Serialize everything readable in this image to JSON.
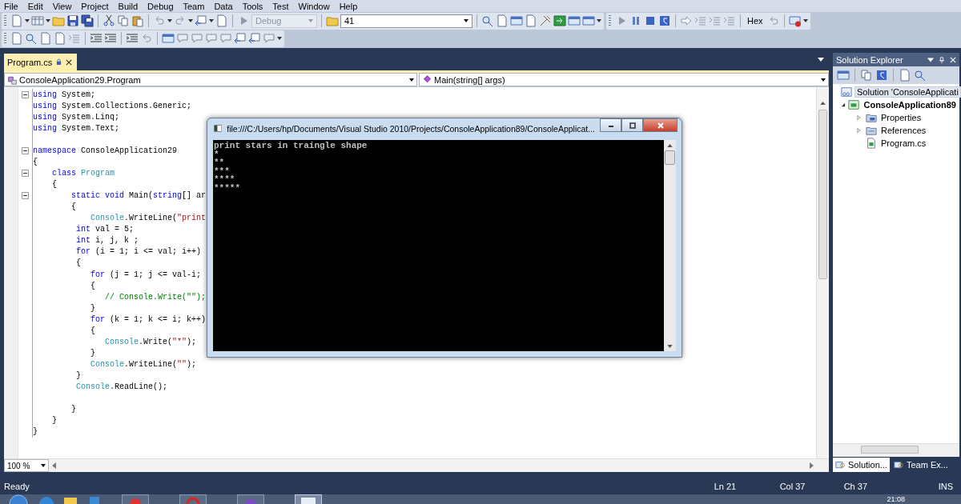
{
  "menu": [
    "File",
    "Edit",
    "View",
    "Project",
    "Build",
    "Debug",
    "Team",
    "Data",
    "Tools",
    "Test",
    "Window",
    "Help"
  ],
  "toolbar": {
    "configuration": {
      "value": "Debug",
      "disabled": true
    },
    "find_box": {
      "value": "41"
    },
    "hex_button": "Hex"
  },
  "tabs": [
    {
      "label": "Program.cs",
      "selected": true,
      "locked": true
    }
  ],
  "nav": {
    "type_dropdown": "ConsoleApplication29.Program",
    "member_dropdown": "Main(string[] args)"
  },
  "code_lines": [
    {
      "fold": true,
      "tokens": [
        {
          "text": "using",
          "kind": "keyword"
        },
        {
          "text": " System;",
          "kind": "plain"
        }
      ]
    },
    {
      "fold": false,
      "tokens": [
        {
          "text": "using",
          "kind": "keyword"
        },
        {
          "text": " System.Collections.Generic;",
          "kind": "plain"
        }
      ]
    },
    {
      "fold": false,
      "tokens": [
        {
          "text": "using",
          "kind": "keyword"
        },
        {
          "text": " System.Linq;",
          "kind": "plain"
        }
      ]
    },
    {
      "fold": false,
      "tokens": [
        {
          "text": "using",
          "kind": "keyword"
        },
        {
          "text": " System.Text;",
          "kind": "plain"
        }
      ]
    },
    {
      "fold": false
    },
    {
      "fold": true,
      "tokens": [
        {
          "text": "namespace",
          "kind": "keyword"
        },
        {
          "text": " ConsoleApplication29",
          "kind": "plain"
        }
      ]
    },
    {
      "fold": false,
      "tokens": [
        {
          "text": "{",
          "kind": "plain"
        }
      ]
    },
    {
      "fold": true,
      "tokens": [
        {
          "text": "    class",
          "kind": "keyword"
        },
        {
          "text": " Program",
          "kind": "type"
        }
      ]
    },
    {
      "fold": false,
      "tokens": [
        {
          "text": "    {",
          "kind": "plain"
        }
      ]
    },
    {
      "fold": true,
      "tokens": [
        {
          "text": "        static void",
          "kind": "keyword"
        },
        {
          "text": " Main(",
          "kind": "plain"
        },
        {
          "text": "string",
          "kind": "keyword"
        },
        {
          "text": "[] ar",
          "kind": "plain"
        }
      ]
    },
    {
      "fold": false,
      "tokens": [
        {
          "text": "        {",
          "kind": "plain"
        }
      ]
    },
    {
      "fold": false,
      "tokens": [
        {
          "text": "            Console",
          "kind": "type"
        },
        {
          "text": ".WriteLine(",
          "kind": "plain"
        },
        {
          "text": "\"print",
          "kind": "string"
        }
      ]
    },
    {
      "fold": false,
      "tokens": [
        {
          "text": "         int",
          "kind": "keyword"
        },
        {
          "text": " val = 5;",
          "kind": "plain"
        }
      ]
    },
    {
      "fold": false,
      "tokens": [
        {
          "text": "         int",
          "kind": "keyword"
        },
        {
          "text": " i, j, k ;",
          "kind": "plain"
        }
      ]
    },
    {
      "fold": false,
      "tokens": [
        {
          "text": "         for",
          "kind": "keyword"
        },
        {
          "text": " (i = 1; i <= val; i++)",
          "kind": "plain"
        }
      ]
    },
    {
      "fold": false,
      "tokens": [
        {
          "text": "         {",
          "kind": "plain"
        }
      ]
    },
    {
      "fold": false,
      "tokens": [
        {
          "text": "            for",
          "kind": "keyword"
        },
        {
          "text": " (j = 1; j <= val-i;",
          "kind": "plain"
        }
      ]
    },
    {
      "fold": false,
      "tokens": [
        {
          "text": "            {",
          "kind": "plain"
        }
      ]
    },
    {
      "fold": false,
      "tokens": [
        {
          "text": "               // Console.Write(\"\");",
          "kind": "comment"
        }
      ]
    },
    {
      "fold": false,
      "tokens": [
        {
          "text": "            }",
          "kind": "plain"
        }
      ]
    },
    {
      "fold": false,
      "tokens": [
        {
          "text": "            for",
          "kind": "keyword"
        },
        {
          "text": " (k = 1; k <= i; k++)",
          "kind": "plain"
        }
      ]
    },
    {
      "fold": false,
      "tokens": [
        {
          "text": "            {",
          "kind": "plain"
        }
      ]
    },
    {
      "fold": false,
      "tokens": [
        {
          "text": "               Console",
          "kind": "type"
        },
        {
          "text": ".Write(",
          "kind": "plain"
        },
        {
          "text": "\"*\"",
          "kind": "string"
        },
        {
          "text": ");",
          "kind": "plain"
        }
      ]
    },
    {
      "fold": false,
      "tokens": [
        {
          "text": "            }",
          "kind": "plain"
        }
      ]
    },
    {
      "fold": false,
      "tokens": [
        {
          "text": "            Console",
          "kind": "type"
        },
        {
          "text": ".WriteLine(",
          "kind": "plain"
        },
        {
          "text": "\"\"",
          "kind": "string"
        },
        {
          "text": ");",
          "kind": "plain"
        }
      ]
    },
    {
      "fold": false,
      "tokens": [
        {
          "text": "         }",
          "kind": "plain"
        }
      ]
    },
    {
      "fold": false,
      "tokens": [
        {
          "text": "         Console",
          "kind": "type"
        },
        {
          "text": ".ReadLine();",
          "kind": "plain"
        }
      ]
    },
    {
      "fold": false
    },
    {
      "fold": false,
      "tokens": [
        {
          "text": "        }",
          "kind": "plain"
        }
      ]
    },
    {
      "fold": false,
      "tokens": [
        {
          "text": "    }",
          "kind": "plain"
        }
      ]
    },
    {
      "fold": false,
      "tokens": [
        {
          "text": "}",
          "kind": "plain"
        }
      ]
    }
  ],
  "zoom": "100 %",
  "console": {
    "title": "file:///C:/Users/hp/Documents/Visual Studio 2010/Projects/ConsoleApplication89/ConsoleApplicat...",
    "lines": [
      "print stars in traingle shape",
      "*",
      "**",
      "***",
      "****",
      "*****"
    ]
  },
  "solution_explorer": {
    "title": "Solution Explorer",
    "tree": [
      {
        "label": "Solution 'ConsoleApplicati",
        "kind": "solution",
        "selected": true,
        "children": [
          {
            "label": "ConsoleApplication89",
            "kind": "project",
            "selected": false,
            "expanded": true,
            "children": [
              {
                "label": "Properties",
                "kind": "folder",
                "selected": false,
                "expanded": false
              },
              {
                "label": "References",
                "kind": "references",
                "selected": false,
                "expanded": false
              },
              {
                "label": "Program.cs",
                "kind": "file",
                "selected": false
              }
            ]
          }
        ]
      }
    ]
  },
  "bottom_tabs": [
    {
      "label": "Solution...",
      "selected": true
    },
    {
      "label": "Team Ex...",
      "selected": false
    }
  ],
  "status_bar": {
    "message": "Ready",
    "line": "Ln 21",
    "col": "Col 37",
    "ch": "Ch 37",
    "mode": "INS"
  },
  "taskbar": {
    "clock": "21:08"
  }
}
